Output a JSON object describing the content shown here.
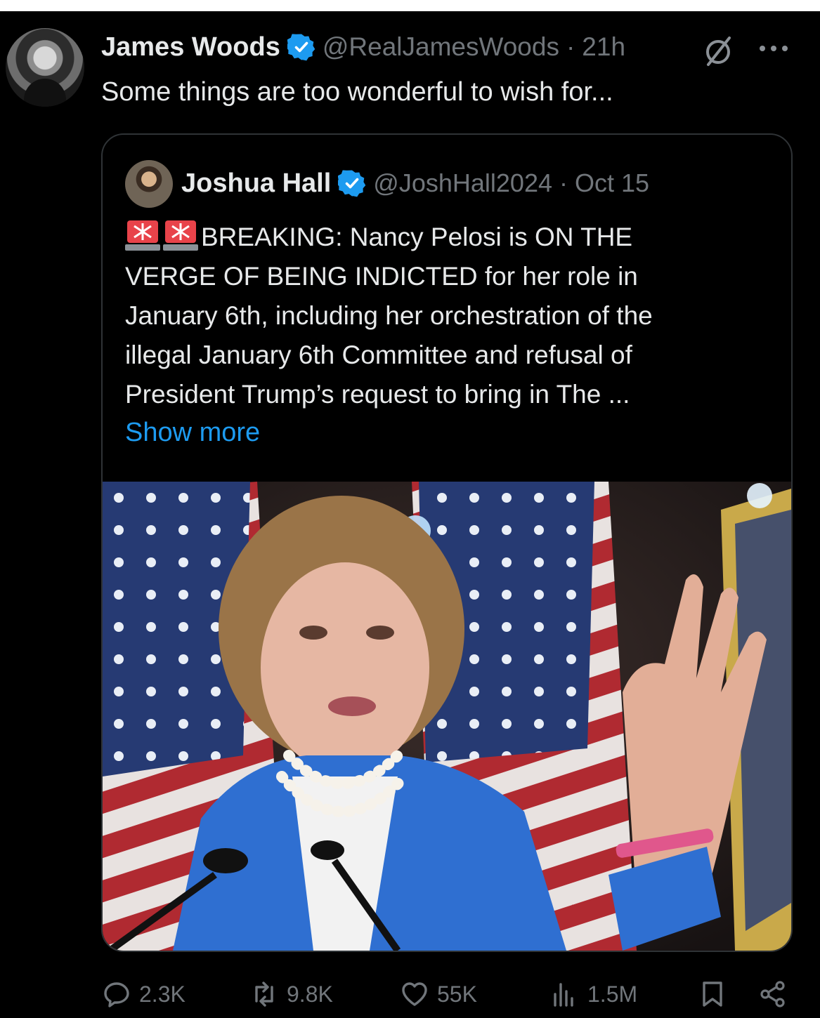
{
  "tweet": {
    "author_name": "James Woods",
    "author_handle": "@RealJamesWoods",
    "time": "21h",
    "text": "Some things are too wonderful to wish for..."
  },
  "quote": {
    "author_name": "Joshua Hall",
    "author_handle": "@JoshHall2024",
    "date": "Oct 15",
    "text_lines": [
      "BREAKING: Nancy Pelosi is ON THE",
      "VERGE OF BEING INDICTED for her role in",
      "January 6th, including her orchestration of the",
      "illegal January 6th Committee and refusal of",
      "President Trump’s request to bring in The ..."
    ],
    "show_more": "Show more",
    "prefix_icons": [
      "siren-icon",
      "siren-icon"
    ]
  },
  "actions": {
    "replies": "2.3K",
    "reposts": "9.8K",
    "likes": "55K",
    "views": "1.5M"
  },
  "colors": {
    "background": "#000000",
    "text_primary": "#e7e9ea",
    "text_secondary": "#71767b",
    "link": "#1d9bf0",
    "verified_badge": "#1d9bf0",
    "border": "#2f3336"
  },
  "icons": [
    "verified-badge-icon",
    "grok-icon",
    "more-icon",
    "reply-icon",
    "repost-icon",
    "like-icon",
    "views-icon",
    "bookmark-icon",
    "share-icon"
  ]
}
